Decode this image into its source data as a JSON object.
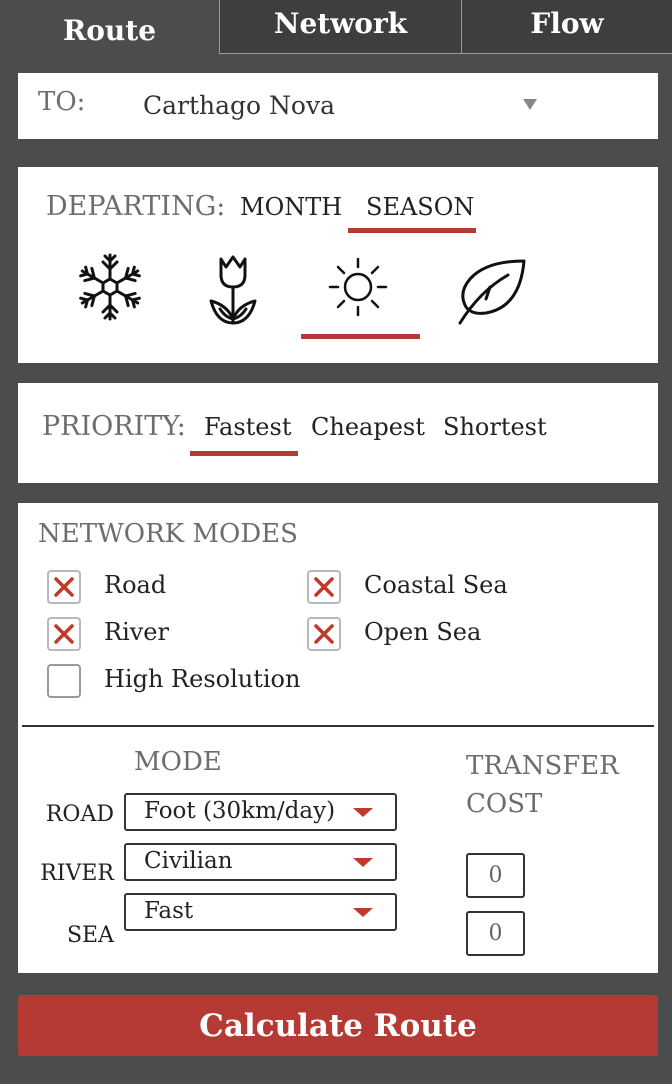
{
  "tabs": [
    {
      "label": "Route"
    },
    {
      "label": "Network"
    },
    {
      "label": "Flow"
    }
  ],
  "destination": {
    "label": "TO:",
    "value": "Carthago Nova"
  },
  "departing": {
    "label": "DEPARTING:",
    "options": [
      "MONTH",
      "SEASON"
    ],
    "selected_option": "SEASON",
    "seasons": [
      {
        "icon": "snowflake-icon"
      },
      {
        "icon": "tulip-icon"
      },
      {
        "icon": "sun-icon"
      },
      {
        "icon": "leaf-icon"
      }
    ],
    "selected_season": "sun-icon"
  },
  "priority": {
    "label": "PRIORITY:",
    "options": [
      "Fastest",
      "Cheapest",
      "Shortest"
    ],
    "selected": "Fastest"
  },
  "network_modes": {
    "title": "NETWORK MODES",
    "checkboxes": [
      {
        "label": "Road",
        "checked": true
      },
      {
        "label": "Coastal Sea",
        "checked": true
      },
      {
        "label": "River",
        "checked": true
      },
      {
        "label": "Open Sea",
        "checked": true
      },
      {
        "label": "High Resolution",
        "checked": false
      }
    ]
  },
  "modes": {
    "mode_header": "MODE",
    "transfer_header_line1": "TRANSFER",
    "transfer_header_line2": "COST",
    "rows": [
      {
        "label": "ROAD",
        "value": "Foot (30km/day)"
      },
      {
        "label": "RIVER",
        "value": "Civilian"
      },
      {
        "label": "SEA",
        "value": "Fast"
      }
    ],
    "transfer_costs": [
      "0",
      "0"
    ]
  },
  "calculate_button": "Calculate Route",
  "colors": {
    "accent": "#b53a33",
    "background": "#4b4d4d",
    "tab_inactive": "#3d3f3f",
    "label_gray": "#6d6d6d"
  }
}
